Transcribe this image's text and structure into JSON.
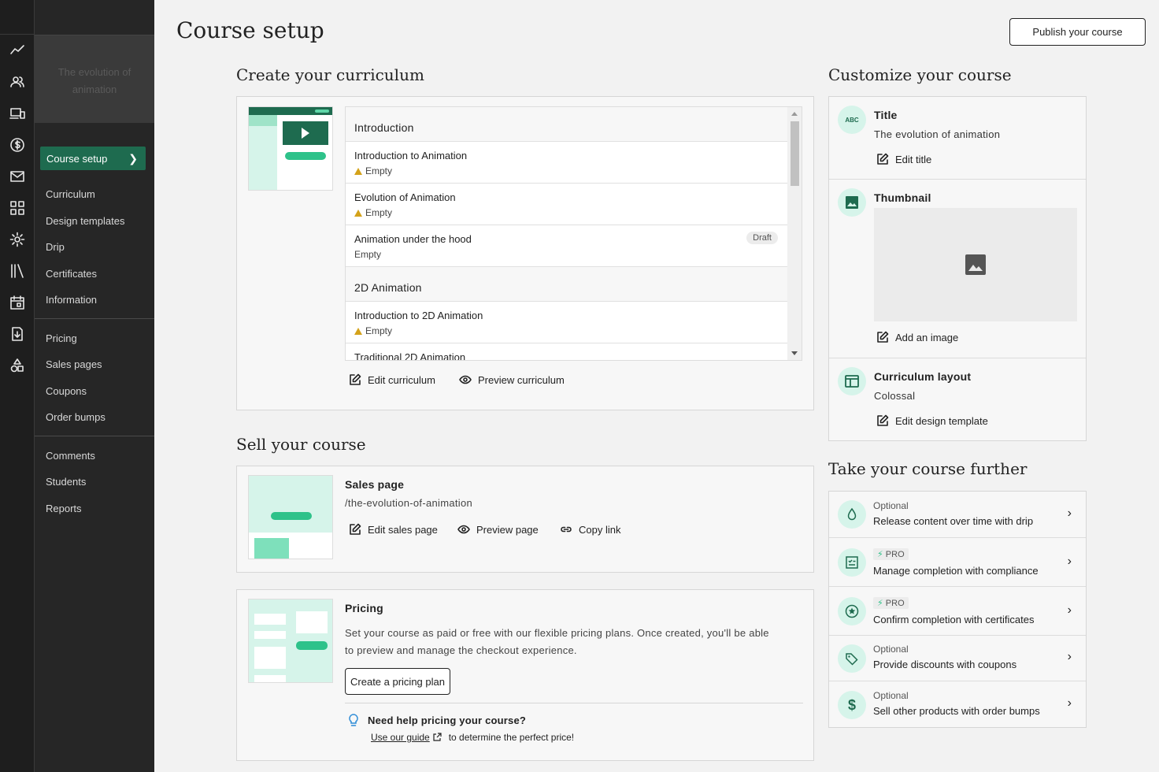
{
  "rail": {
    "icons": [
      "analytics-icon",
      "users-icon",
      "devices-icon",
      "dollar-icon",
      "mail-icon",
      "grid-icon",
      "gear-icon",
      "library-icon",
      "calendar-icon",
      "download-icon",
      "shapes-icon"
    ]
  },
  "menu": {
    "course_name": "The evolution of animation",
    "active": "Course setup",
    "group1": [
      "Curriculum",
      "Design templates",
      "Drip",
      "Certificates",
      "Information"
    ],
    "group2": [
      "Pricing",
      "Sales pages",
      "Coupons",
      "Order bumps"
    ],
    "group3": [
      "Comments",
      "Students",
      "Reports"
    ]
  },
  "header": {
    "title": "Course setup",
    "publish": "Publish your course"
  },
  "curriculum": {
    "heading": "Create your curriculum",
    "chapter1": "Introduction",
    "chapter2": "2D Animation",
    "lessons": [
      {
        "title": "Introduction to Animation",
        "status": "Empty"
      },
      {
        "title": "Evolution of Animation",
        "status": "Empty"
      },
      {
        "title": "Animation under the hood",
        "status": "Empty",
        "badge": "Draft"
      },
      {
        "title": "Introduction to 2D Animation",
        "status": "Empty"
      },
      {
        "title": "Traditional 2D Animation",
        "status": ""
      }
    ],
    "edit": "Edit curriculum",
    "preview": "Preview curriculum"
  },
  "sell": {
    "heading": "Sell your course",
    "sales_label": "Sales page",
    "sales_slug": "/the-evolution-of-animation",
    "edit_sales": "Edit sales page",
    "preview_page": "Preview page",
    "copy_link": "Copy link",
    "pricing_label": "Pricing",
    "pricing_desc1": "Set your course as paid or free with our flexible pricing plans. Once created, you'll be able",
    "pricing_desc2": "to preview and manage the checkout experience.",
    "create_plan": "Create a pricing plan",
    "help_title": "Need help pricing your course?",
    "help_link": "Use our guide",
    "help_rest": "to determine the perfect price!"
  },
  "customize": {
    "heading": "Customize your course",
    "title_label": "Title",
    "title_value": "The evolution of animation",
    "edit_title": "Edit title",
    "thumb_label": "Thumbnail",
    "add_image": "Add an image",
    "layout_label": "Curriculum layout",
    "layout_value": "Colossal",
    "edit_template": "Edit design template",
    "abc_text": "ABC"
  },
  "further": {
    "heading": "Take your course further",
    "items": [
      {
        "tag": "Optional",
        "text": "Release content over time with drip",
        "icon": "drop-icon"
      },
      {
        "tag": "PRO",
        "text": "Manage completion with compliance",
        "icon": "checklist-icon"
      },
      {
        "tag": "PRO",
        "text": "Confirm completion with certificates",
        "icon": "star-badge-icon"
      },
      {
        "tag": "Optional",
        "text": "Provide discounts with coupons",
        "icon": "tag-icon"
      },
      {
        "tag": "Optional",
        "text": "Sell other products with order bumps",
        "icon": "dollar-icon"
      }
    ]
  },
  "colors": {
    "accent": "#1e6b4f",
    "mint": "#d6f4ea",
    "green": "#2ec28a"
  }
}
